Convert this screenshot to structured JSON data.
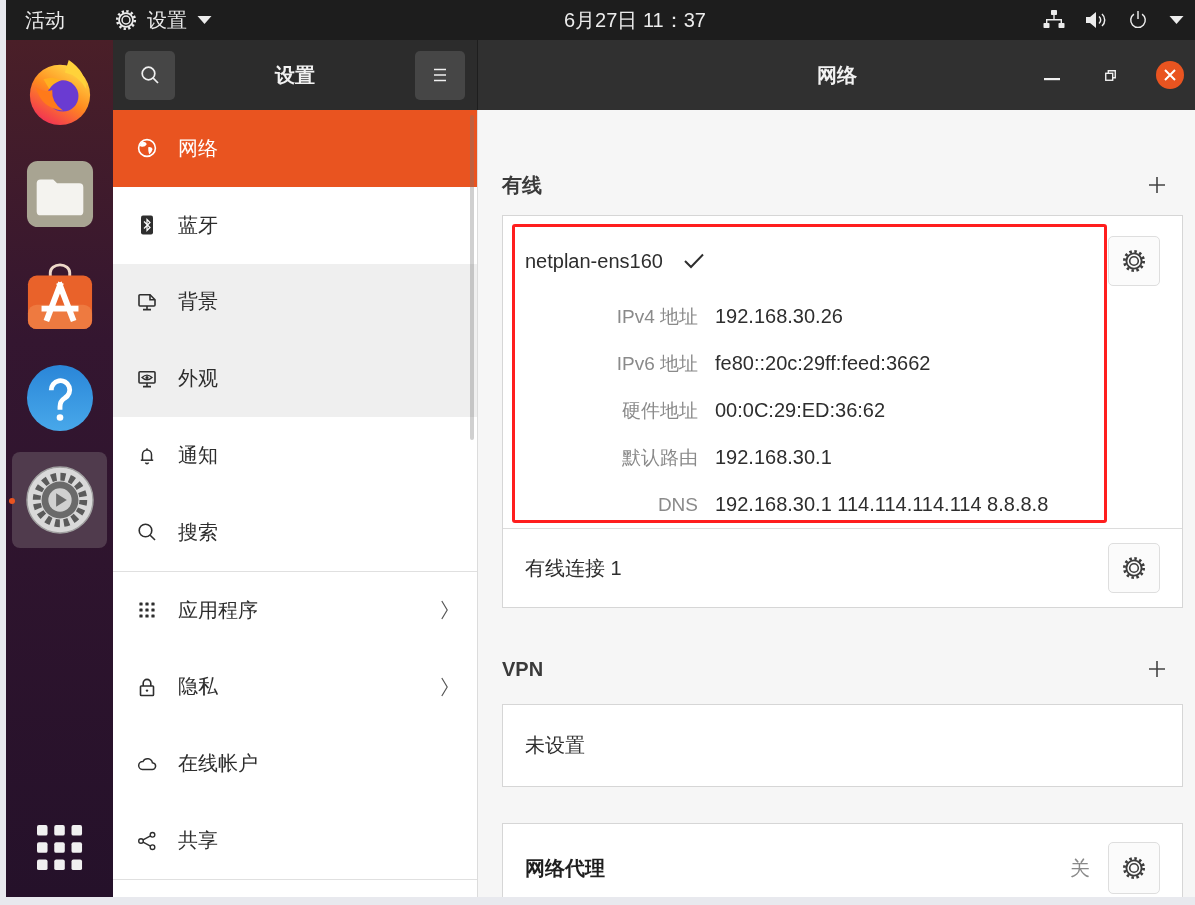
{
  "top_bar": {
    "activities": "活动",
    "app_menu": "设置",
    "clock": "6月27日 11：37"
  },
  "dock": {
    "items": [
      {
        "kind": "browser",
        "selected": false,
        "running": false
      },
      {
        "kind": "files",
        "selected": false,
        "running": false
      },
      {
        "kind": "store",
        "selected": false,
        "running": false
      },
      {
        "kind": "help",
        "selected": false,
        "running": false
      },
      {
        "kind": "settings",
        "selected": true,
        "running": true
      },
      {
        "kind": "apps",
        "selected": false,
        "running": false
      }
    ]
  },
  "sidebar": {
    "title": "设置",
    "groups": [
      {
        "items": [
          {
            "label": "网络",
            "kind": "globe",
            "selected": true,
            "highlighted": false,
            "submenu": false
          },
          {
            "label": "蓝牙",
            "kind": "bluetooth",
            "selected": false,
            "highlighted": false,
            "submenu": false
          },
          {
            "label": "背景",
            "kind": "wallpaper",
            "selected": false,
            "highlighted": true,
            "submenu": false
          },
          {
            "label": "外观",
            "kind": "appearance",
            "selected": false,
            "highlighted": true,
            "submenu": false
          },
          {
            "label": "通知",
            "kind": "bell",
            "selected": false,
            "highlighted": false,
            "submenu": false
          },
          {
            "label": "搜索",
            "kind": "search",
            "selected": false,
            "highlighted": false,
            "submenu": false
          }
        ]
      },
      {
        "items": [
          {
            "label": "应用程序",
            "kind": "grid",
            "selected": false,
            "highlighted": false,
            "submenu": true
          },
          {
            "label": "隐私",
            "kind": "lock",
            "selected": false,
            "highlighted": false,
            "submenu": true
          },
          {
            "label": "在线帐户",
            "kind": "cloud",
            "selected": false,
            "highlighted": false,
            "submenu": false
          },
          {
            "label": "共享",
            "kind": "share",
            "selected": false,
            "highlighted": false,
            "submenu": false
          }
        ]
      }
    ]
  },
  "window": {
    "title": "网络"
  },
  "wired": {
    "title": "有线",
    "connections": [
      {
        "name": "netplan-ens160",
        "active": true,
        "highlighted": true,
        "details": [
          {
            "label": "IPv4 地址",
            "value": "192.168.30.26"
          },
          {
            "label": "IPv6 地址",
            "value": "fe80::20c:29ff:feed:3662"
          },
          {
            "label": "硬件地址",
            "value": "00:0C:29:ED:36:62"
          },
          {
            "label": "默认路由",
            "value": "192.168.30.1"
          },
          {
            "label": "DNS",
            "value": "192.168.30.1 114.114.114.114 8.8.8.8"
          }
        ]
      },
      {
        "name": "有线连接 1",
        "active": false,
        "highlighted": false
      }
    ]
  },
  "vpn": {
    "title": "VPN",
    "empty_text": "未设置"
  },
  "proxy": {
    "title": "网络代理",
    "status": "关"
  }
}
